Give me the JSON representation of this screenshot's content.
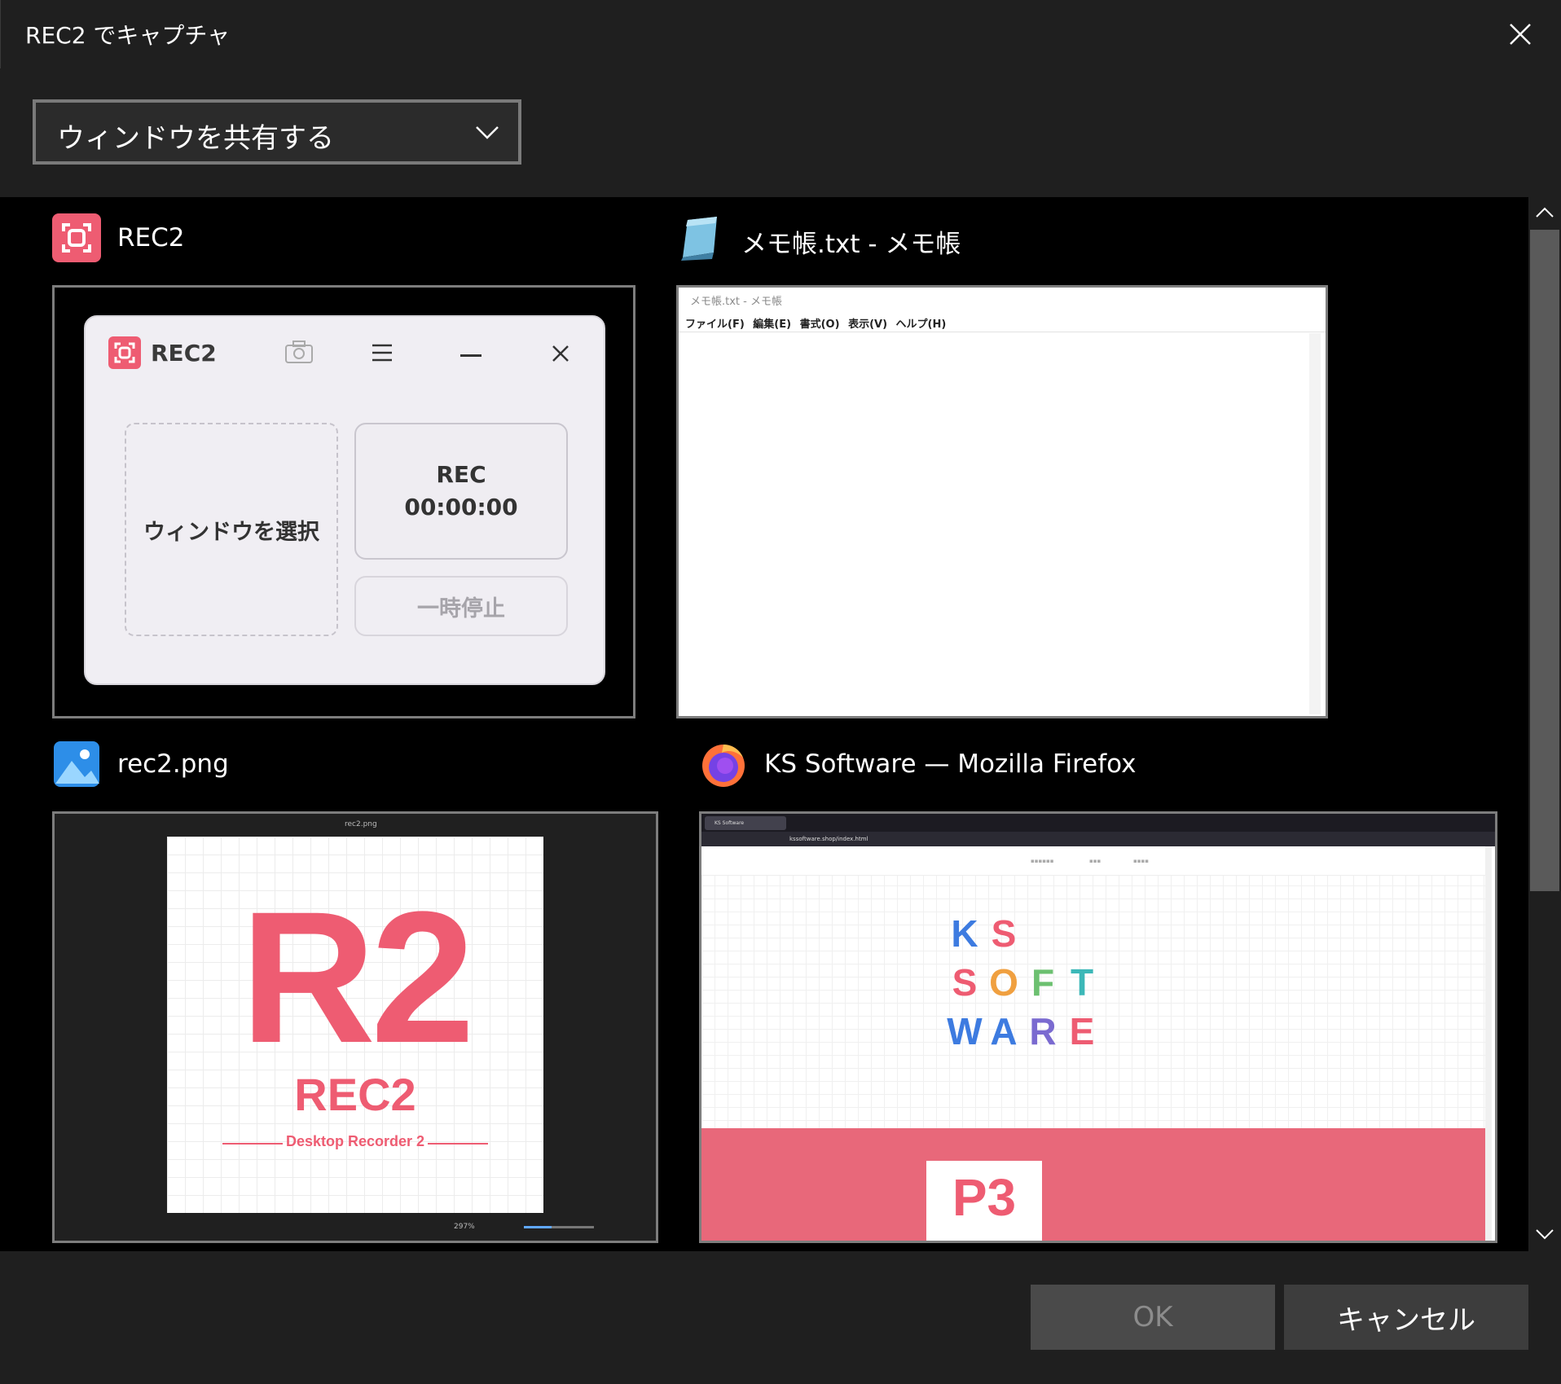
{
  "dialog": {
    "title": "REC2 でキャプチャ"
  },
  "mode_select": {
    "value": "ウィンドウを共有する"
  },
  "windows": [
    {
      "title": "REC2",
      "icon": "rec2-app-icon",
      "preview": {
        "app_name": "REC2",
        "select_label": "ウィンドウを選択",
        "rec_label": "REC",
        "rec_time": "00:00:00",
        "pause_label": "一時停止"
      }
    },
    {
      "title": "メモ帳.txt - メモ帳",
      "icon": "notepad-icon",
      "preview": {
        "window_title": "メモ帳.txt - メモ帳",
        "menu": [
          "ファイル(F)",
          "編集(E)",
          "書式(O)",
          "表示(V)",
          "ヘルプ(H)"
        ]
      }
    },
    {
      "title": "rec2.png",
      "icon": "photos-icon",
      "preview": {
        "file_name": "rec2.png",
        "big_text": "R2",
        "mid_text": "REC2",
        "sub_text": "Desktop Recorder 2",
        "zoom": "297%",
        "zoom_fraction": 0.4
      }
    },
    {
      "title": "KS Software — Mozilla Firefox",
      "icon": "firefox-icon",
      "preview": {
        "tab_title": "KS Software",
        "url": "kssoftware.shop/index.html",
        "logo_rows": [
          [
            "K",
            "S"
          ],
          [
            "S",
            "O",
            "F",
            "T"
          ],
          [
            "W",
            "A",
            "R",
            "E"
          ]
        ],
        "logo_colors": [
          "#3d7be0",
          "#ee5c72",
          "#ee5c72",
          "#f0a040",
          "#6cc070",
          "#3cb8b8",
          "#3d7be0",
          "#3d7be0",
          "#7a6ad0",
          "#ee5c72"
        ],
        "card_text": "P3"
      }
    }
  ],
  "buttons": {
    "ok": "OK",
    "cancel": "キャンセル"
  },
  "colors": {
    "accent": "#ee5c72",
    "background": "#1f1f1f",
    "grid_bg": "#000000"
  }
}
